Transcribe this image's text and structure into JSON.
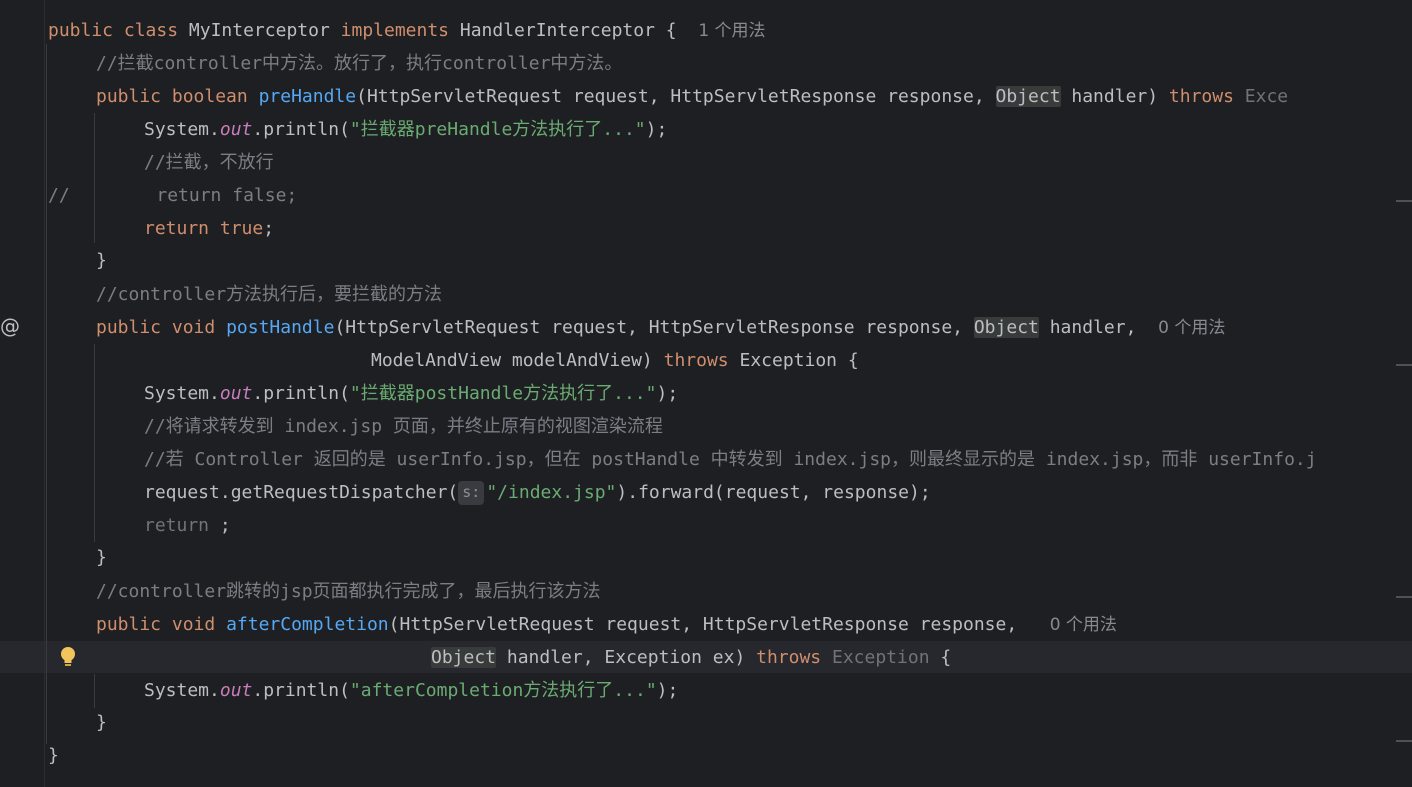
{
  "code": {
    "l1": {
      "kw1": "public",
      "kw2": "class",
      "name": "MyInterceptor",
      "kw3": "implements",
      "iface": "HandlerInterceptor",
      "brace": " {",
      "hint": "1 个用法"
    },
    "l2": {
      "comment": "//拦截controller中方法。放行了，执行controller中方法。"
    },
    "l3": {
      "kw1": "public",
      "kw2": "boolean",
      "fn": "preHandle",
      "p1": "(HttpServletRequest request, HttpServletResponse response, ",
      "obj": "Object",
      "p2": " handler) ",
      "kw3": "throws",
      "exc": " Exce"
    },
    "l4": {
      "sys": "System.",
      "out": "out",
      "pr": ".println(",
      "str": "\"拦截器preHandle方法执行了...\"",
      "end": ");"
    },
    "l5": {
      "comment": "//拦截，不放行"
    },
    "l6": {
      "comment": "//        return false;"
    },
    "l7": {
      "kw": "return",
      "val": "true",
      "end": ";"
    },
    "l8": {
      "brace": "}"
    },
    "l9": {
      "comment": "//controller方法执行后，要拦截的方法"
    },
    "l10": {
      "kw1": "public",
      "kw2": "void",
      "fn": "postHandle",
      "p1": "(HttpServletRequest request, HttpServletResponse response, ",
      "obj": "Object",
      "p2": " handler,",
      "hint": "0 个用法"
    },
    "l11": {
      "p": "ModelAndView modelAndView) ",
      "kw": "throws",
      "exc": " Exception {"
    },
    "l12": {
      "sys": "System.",
      "out": "out",
      "pr": ".println(",
      "str": "\"拦截器postHandle方法执行了...\"",
      "end": ");"
    },
    "l13": {
      "comment": "//将请求转发到 index.jsp 页面，并终止原有的视图渲染流程"
    },
    "l14": {
      "comment": "//若 Controller 返回的是 userInfo.jsp，但在 postHandle 中转发到 index.jsp，则最终显示的是 index.jsp，而非 userInfo.j"
    },
    "l15": {
      "pre": "request.getRequestDispatcher(",
      "inlay": "s:",
      "str": "\"/index.jsp\"",
      "post": ").forward(request, response);"
    },
    "l16": {
      "kw": "return",
      "end": " ;"
    },
    "l17": {
      "brace": "}"
    },
    "l18": {
      "comment": "//controller跳转的jsp页面都执行完成了，最后执行该方法"
    },
    "l19": {
      "kw1": "public",
      "kw2": "void",
      "fn": "afterCompletion",
      "p1": "(HttpServletRequest request, HttpServletResponse response,",
      "hint": "0 个用法"
    },
    "l20": {
      "obj": "Object",
      "p": " handler, Exception ex) ",
      "kw": "throws",
      "exc": " Exception",
      "brace": " {"
    },
    "l21": {
      "sys": "System.",
      "out": "out",
      "pr": ".println(",
      "str": "\"afterCompletion方法执行了...\"",
      "end": ");"
    },
    "l22": {
      "brace": "}"
    },
    "l23": {
      "brace": "}"
    }
  },
  "gutter": {
    "at_icon": "@",
    "bulb_icon": "lightbulb-icon"
  },
  "colors": {
    "background": "#1e1f22",
    "keyword": "#cf8e6d",
    "function": "#56a8f5",
    "string": "#6aab73",
    "comment": "#7a7e85",
    "static_field": "#c77dbb"
  }
}
